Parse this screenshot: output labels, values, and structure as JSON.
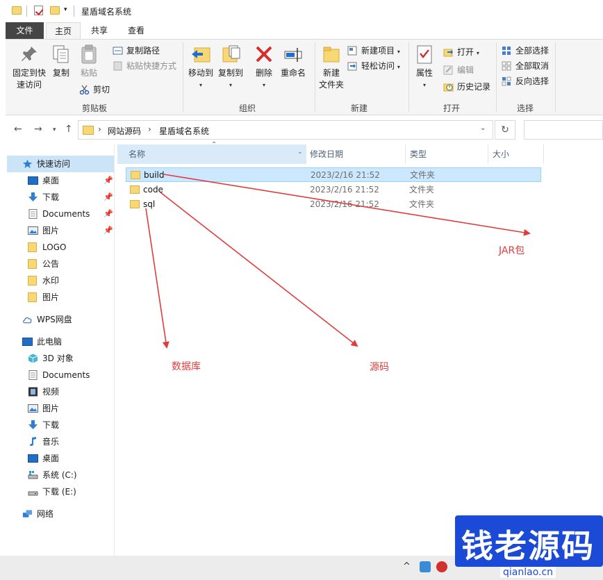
{
  "window": {
    "title": "星盾域名系统"
  },
  "ribbon_tabs": [
    "文件",
    "主页",
    "共享",
    "查看"
  ],
  "ribbon": {
    "clipboard": {
      "pin_label_1": "固定到快",
      "pin_label_2": "速访问",
      "copy": "复制",
      "paste": "粘贴",
      "copy_path": "复制路径",
      "paste_shortcut": "粘贴快捷方式",
      "cut": "剪切",
      "group": "剪贴板"
    },
    "organize": {
      "move_to": "移动到",
      "copy_to": "复制到",
      "delete": "删除",
      "rename": "重命名",
      "group": "组织"
    },
    "new": {
      "new_folder_1": "新建",
      "new_folder_2": "文件夹",
      "new_item": "新建项目",
      "easy_access": "轻松访问",
      "group": "新建"
    },
    "open": {
      "properties": "属性",
      "open": "打开",
      "edit": "编辑",
      "history": "历史记录",
      "group": "打开"
    },
    "select": {
      "select_all": "全部选择",
      "select_none": "全部取消",
      "invert": "反向选择",
      "group": "选择"
    }
  },
  "address": {
    "crumbs": [
      "网站源码",
      "星盾域名系统"
    ]
  },
  "nav": {
    "quick_access": "快速访问",
    "pinned": [
      "桌面",
      "下载",
      "Documents",
      "图片"
    ],
    "recent": [
      "LOGO",
      "公告",
      "水印",
      "图片"
    ],
    "wps": "WPS网盘",
    "this_pc": "此电脑",
    "pc_items": [
      "3D 对象",
      "Documents",
      "视频",
      "图片",
      "下载",
      "音乐",
      "桌面",
      "系统 (C:)",
      "下载 (E:)"
    ],
    "network": "网络"
  },
  "columns": {
    "name": "名称",
    "modified": "修改日期",
    "type": "类型",
    "size": "大小"
  },
  "files": [
    {
      "name": "build",
      "modified": "2023/2/16 21:52",
      "type": "文件夹"
    },
    {
      "name": "code",
      "modified": "2023/2/16 21:52",
      "type": "文件夹"
    },
    {
      "name": "sql",
      "modified": "2023/2/16 21:52",
      "type": "文件夹"
    }
  ],
  "annotations": {
    "jar": "JAR包",
    "database": "数据库",
    "source": "源码"
  },
  "watermark": {
    "brand": "钱老源码",
    "url": "qianlao.cn"
  },
  "colors": {
    "arrow": "#e03c3c",
    "selection": "#cce8ff",
    "watermark": "#1a4ad6"
  }
}
